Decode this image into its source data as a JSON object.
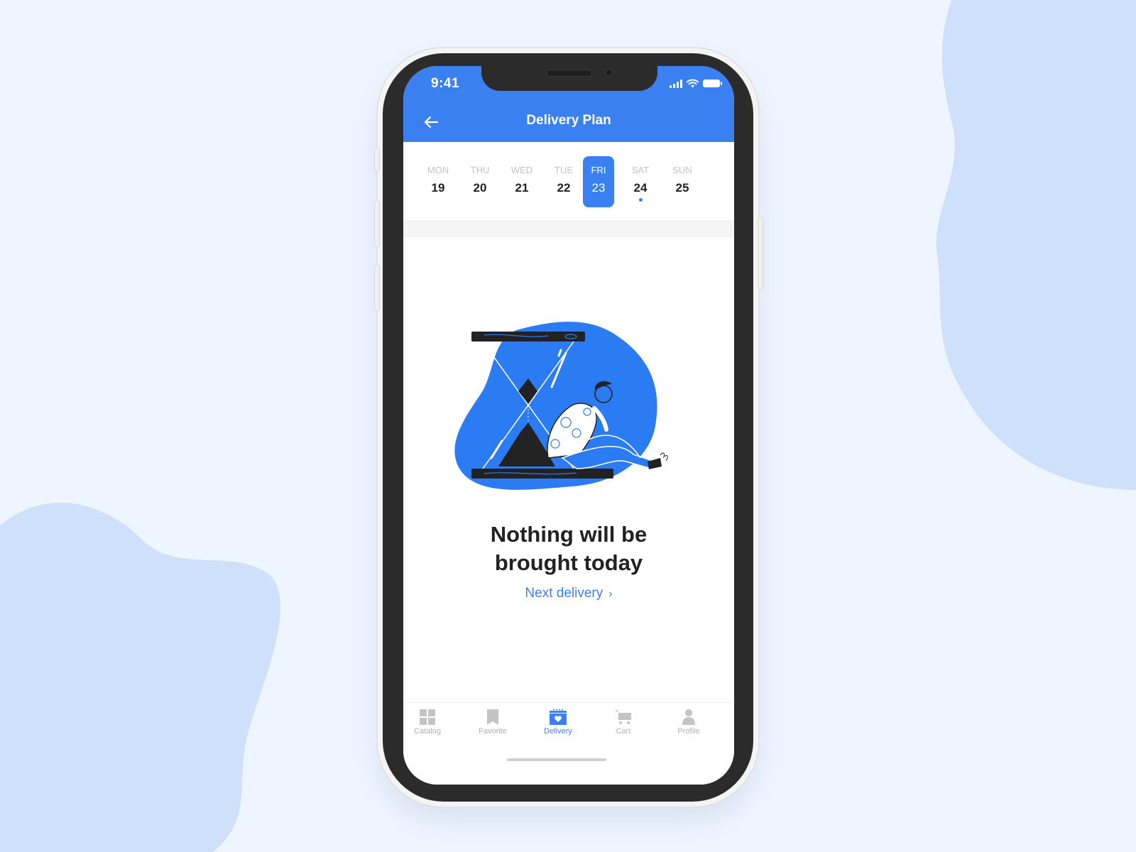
{
  "colors": {
    "accent": "#3a80f0",
    "background": "#eef5ff",
    "blob": "#cfe0fa",
    "text_dark": "#222222",
    "text_muted": "#b0b0b0"
  },
  "status_bar": {
    "time": "9:41",
    "icons": [
      "cellular-signal-icon",
      "wifi-icon",
      "battery-icon"
    ]
  },
  "header": {
    "back_icon": "arrow-left-icon",
    "title": "Delivery Plan"
  },
  "week": {
    "days": [
      {
        "name": "MON",
        "date": "19",
        "selected": false,
        "has_delivery": false
      },
      {
        "name": "THU",
        "date": "20",
        "selected": false,
        "has_delivery": false
      },
      {
        "name": "WED",
        "date": "21",
        "selected": false,
        "has_delivery": false
      },
      {
        "name": "TUE",
        "date": "22",
        "selected": false,
        "has_delivery": false
      },
      {
        "name": "FRI",
        "date": "23",
        "selected": true,
        "has_delivery": false
      },
      {
        "name": "SAT",
        "date": "24",
        "selected": false,
        "has_delivery": true
      },
      {
        "name": "SUN",
        "date": "25",
        "selected": false,
        "has_delivery": false
      }
    ]
  },
  "empty_state": {
    "illustration": "hourglass-person-waiting-illustration",
    "title_line1": "Nothing will be",
    "title_line2": "brought today",
    "link_label": "Next delivery",
    "link_icon": "chevron-right-icon"
  },
  "tabbar": {
    "items": [
      {
        "label": "Catalog",
        "icon": "grid-icon",
        "active": false
      },
      {
        "label": "Favorite",
        "icon": "bookmark-icon",
        "active": false
      },
      {
        "label": "Delivery",
        "icon": "calendar-heart-icon",
        "active": true
      },
      {
        "label": "Cart",
        "icon": "cart-icon",
        "active": false
      },
      {
        "label": "Profile",
        "icon": "person-icon",
        "active": false
      }
    ]
  }
}
